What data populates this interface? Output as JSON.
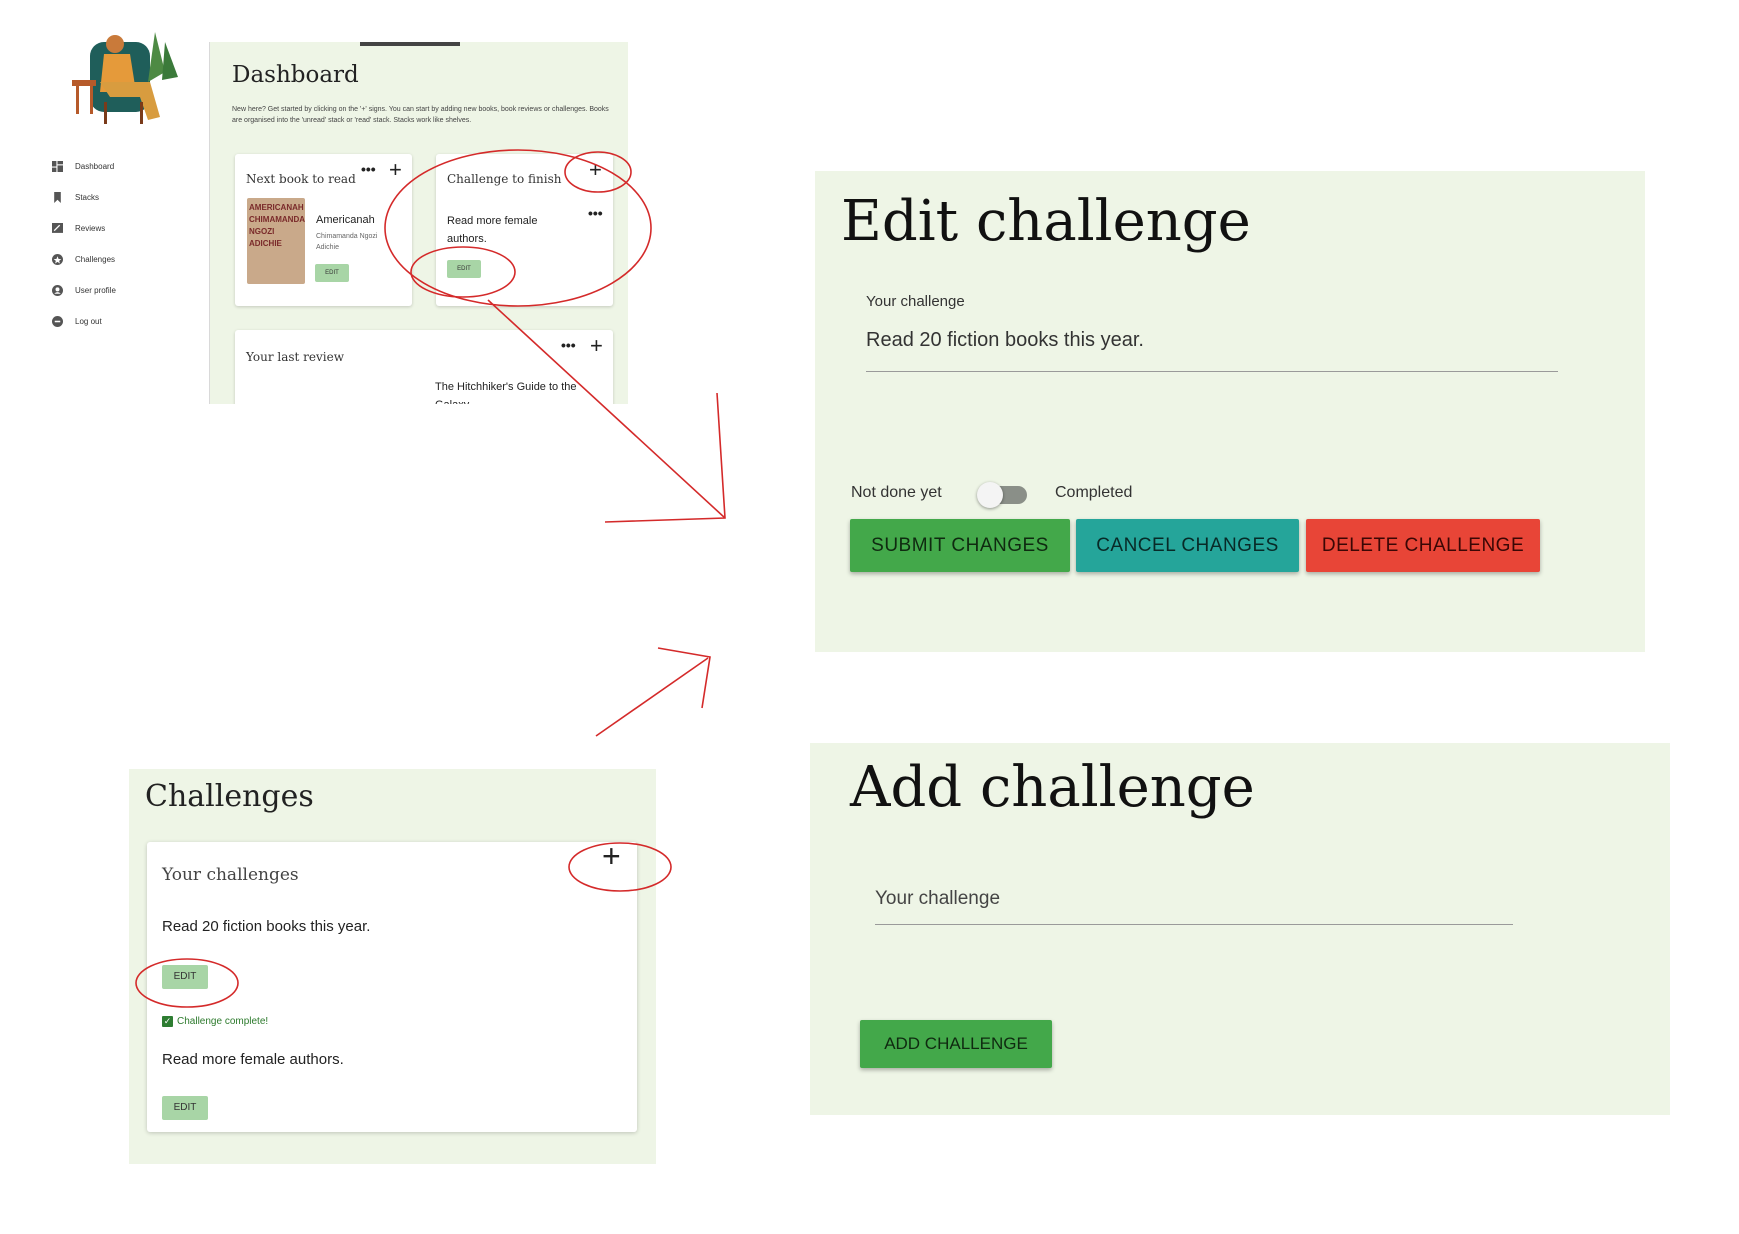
{
  "dashboard": {
    "title": "Dashboard",
    "intro": "New here? Get started by clicking on the '+' signs. You can start by adding new books, book reviews or challenges. Books are organised into the 'unread' stack or 'read' stack. Stacks work like shelves.",
    "nav": [
      {
        "label": "Dashboard",
        "icon": "dashboard-icon"
      },
      {
        "label": "Stacks",
        "icon": "bookmark-icon"
      },
      {
        "label": "Reviews",
        "icon": "review-icon"
      },
      {
        "label": "Challenges",
        "icon": "star-icon"
      },
      {
        "label": "User profile",
        "icon": "user-icon"
      },
      {
        "label": "Log out",
        "icon": "logout-icon"
      }
    ],
    "next_book": {
      "card_title": "Next book to read",
      "book_title": "Americanah",
      "author": "Chimamanda Ngozi Adichie",
      "cover_lines": [
        "AMERICANAH",
        "CHIMAMANDA",
        "NGOZI",
        "ADICHIE"
      ],
      "edit_label": "EDIT"
    },
    "challenge_card": {
      "card_title": "Challenge to finish",
      "challenge": "Read more female authors.",
      "edit_label": "EDIT"
    },
    "last_review": {
      "card_title": "Your last review",
      "book_title": "The Hitchhiker's Guide to the Galaxy"
    },
    "more_label": "•••",
    "plus_label": "+"
  },
  "edit_challenge": {
    "title": "Edit challenge",
    "field_label": "Your challenge",
    "field_value": "Read 20 fiction books this year.",
    "toggle_left": "Not done yet",
    "toggle_right": "Completed",
    "toggle_on": false,
    "buttons": {
      "submit": "SUBMIT CHANGES",
      "cancel": "CANCEL CHANGES",
      "delete": "DELETE CHALLENGE"
    }
  },
  "add_challenge": {
    "title": "Add challenge",
    "field_placeholder": "Your challenge",
    "button": "ADD CHALLENGE"
  },
  "challenges": {
    "title": "Challenges",
    "card_title": "Your challenges",
    "plus_label": "+",
    "items": [
      {
        "text": "Read 20 fiction books this year.",
        "edit_label": "EDIT",
        "complete_text": "Challenge complete!"
      },
      {
        "text": "Read more female authors.",
        "edit_label": "EDIT"
      }
    ]
  },
  "colors": {
    "panel_bg": "#eef5e6",
    "submit": "#43a84a",
    "cancel": "#25a59a",
    "delete": "#e84537",
    "edit_chip": "#a8d5a6",
    "annotation": "#d42a2a"
  }
}
